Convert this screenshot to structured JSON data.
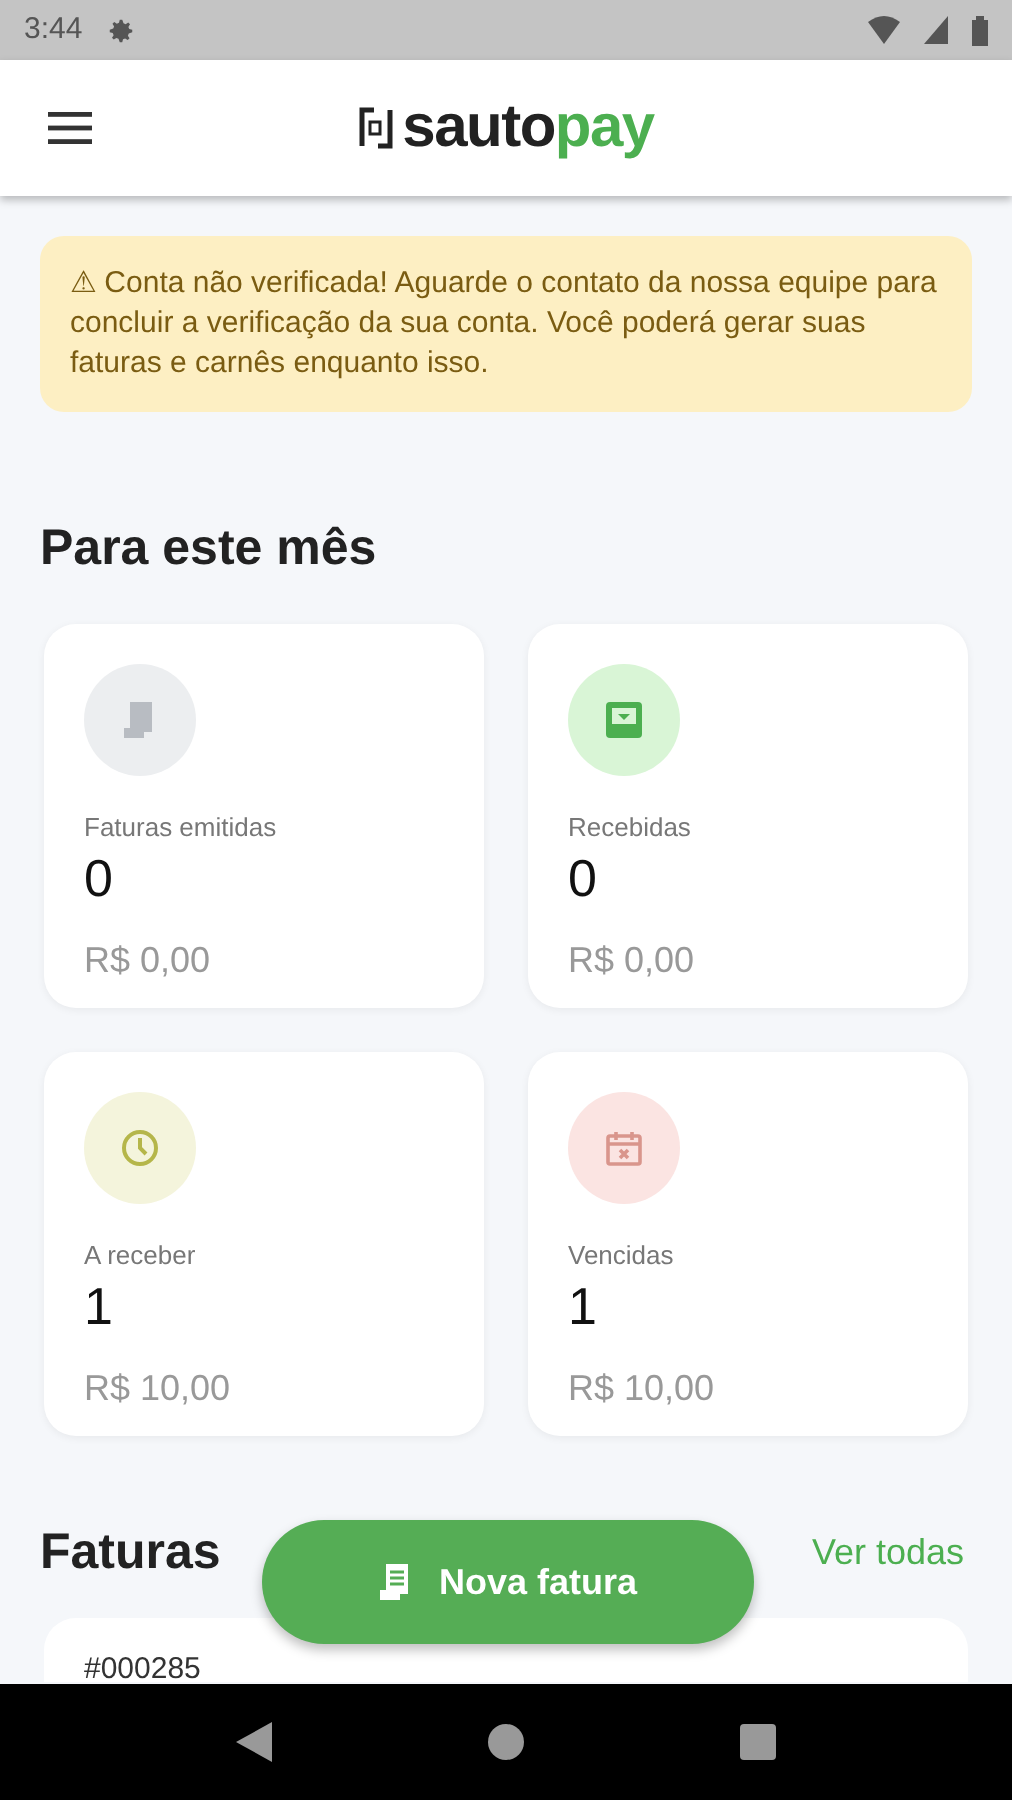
{
  "status_bar": {
    "time": "3:44"
  },
  "app_bar": {
    "logo_dark": "sauto",
    "logo_accent": "pay"
  },
  "alert": {
    "icon": "⚠",
    "text": "Conta não verificada! Aguarde o contato da nossa equipe para concluir a verificação da sua conta. Você poderá gerar suas faturas e carnês enquanto isso."
  },
  "month_section": {
    "title": "Para este mês",
    "cards": [
      {
        "kind": "invoice",
        "color": "#eceef0",
        "label": "Faturas emitidas",
        "count": "0",
        "amount": "R$ 0,00"
      },
      {
        "kind": "inbox",
        "color": "#d9f5d6",
        "label": "Recebidas",
        "count": "0",
        "amount": "R$ 0,00"
      },
      {
        "kind": "clock",
        "color": "#f4f4dc",
        "label": "A receber",
        "count": "1",
        "amount": "R$ 10,00"
      },
      {
        "kind": "calendar",
        "color": "#fbe4e2",
        "label": "Vencidas",
        "count": "1",
        "amount": "R$ 10,00"
      }
    ]
  },
  "invoices_section": {
    "title": "Faturas",
    "link": "Ver todas",
    "first_invoice": "#000285"
  },
  "fab": {
    "label": "Nova fatura"
  }
}
